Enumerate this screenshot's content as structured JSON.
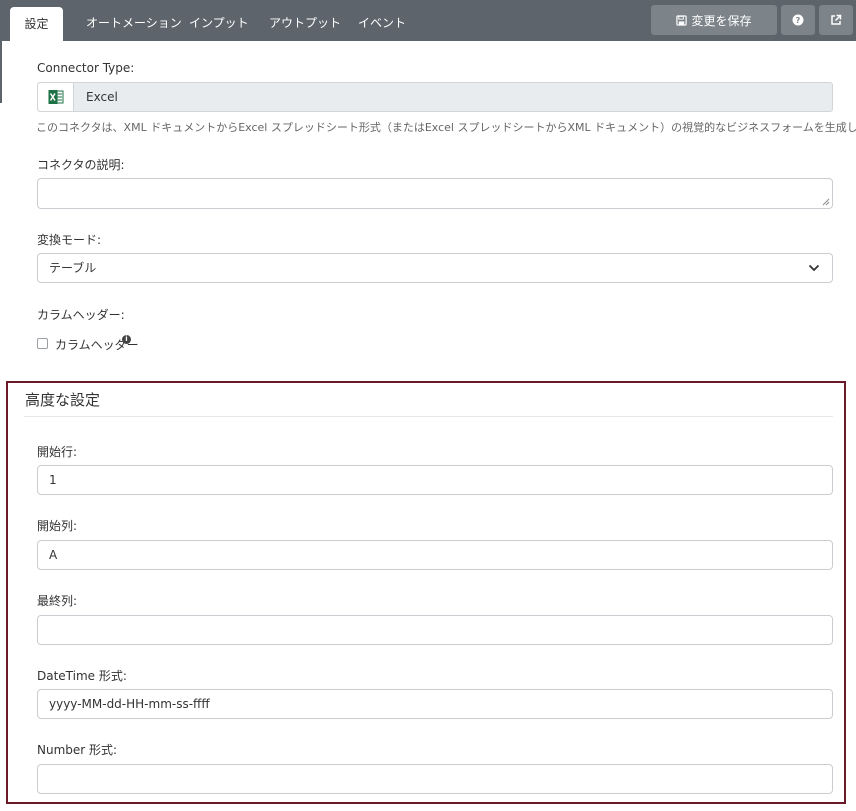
{
  "tabs": [
    "設定",
    "オートメーション",
    "インプット",
    "アウトプット",
    "イベント"
  ],
  "toolbar": {
    "save_label": "変更を保存"
  },
  "connector_type": {
    "label": "Connector Type:",
    "value": "Excel"
  },
  "description_text": "このコネクタは、XML ドキュメントからExcel スプレッドシート形式（またはExcel スプレッドシートからXML ドキュメント）の視覚的なビジネスフォームを生成します。",
  "connector_description": {
    "label": "コネクタの説明:",
    "value": ""
  },
  "conversion_mode": {
    "label": "変換モード:",
    "value": "テーブル"
  },
  "column_header": {
    "label": "カラムヘッダー:",
    "checkbox_label": "カラムヘッダー",
    "checked": false
  },
  "advanced": {
    "title": "高度な設定",
    "start_row": {
      "label": "開始行:",
      "value": "1"
    },
    "start_col": {
      "label": "開始列:",
      "value": "A"
    },
    "end_col": {
      "label": "最終列:",
      "value": ""
    },
    "datetime_format": {
      "label": "DateTime 形式:",
      "value": "yyyy-MM-dd-HH-mm-ss-ffff"
    },
    "number_format": {
      "label": "Number 形式:",
      "value": ""
    }
  },
  "colors": {
    "topbar": "#5d646b",
    "button": "#7c8389",
    "panel_border": "#6b1a2a",
    "excel_green": "#1e7145"
  }
}
